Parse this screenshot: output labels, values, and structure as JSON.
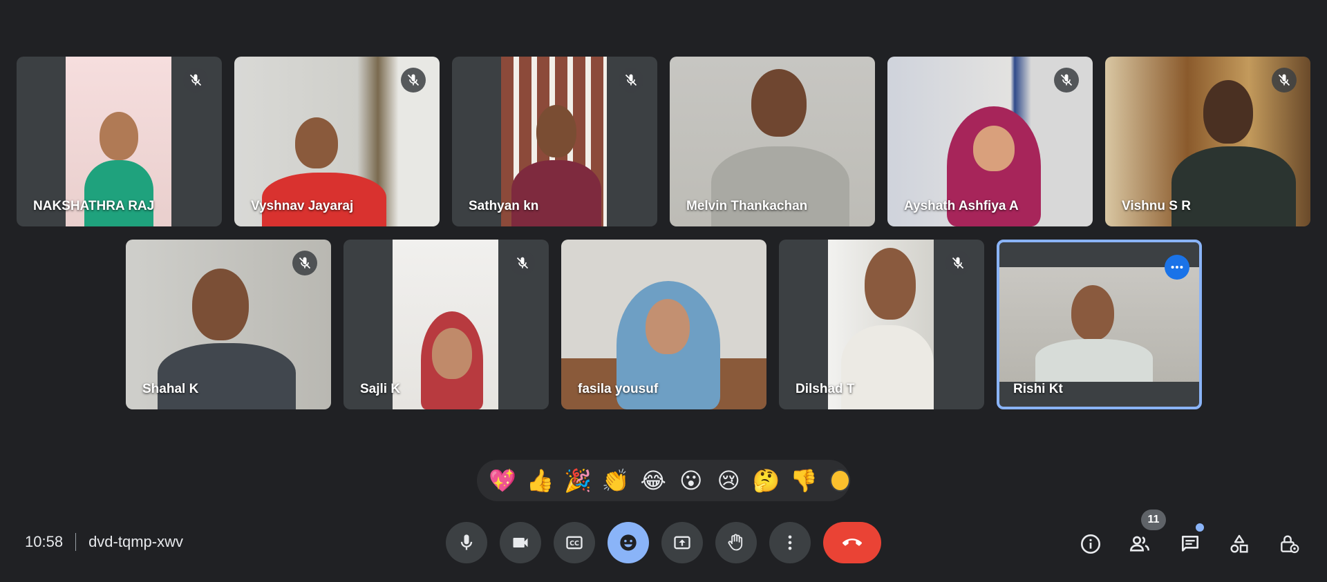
{
  "participants_row1": [
    {
      "name": "NAKSHATHRA RAJ",
      "muted": true
    },
    {
      "name": "Vyshnav Jayaraj",
      "muted": true
    },
    {
      "name": "Sathyan kn",
      "muted": true
    },
    {
      "name": "Melvin Thankachan",
      "muted": false
    },
    {
      "name": "Ayshath Ashfiya A",
      "muted": true
    },
    {
      "name": "Vishnu S R",
      "muted": true
    }
  ],
  "participants_row2": [
    {
      "name": "Shahal K",
      "muted": true
    },
    {
      "name": "Sajli K",
      "muted": true
    },
    {
      "name": "fasila yousuf",
      "muted": false
    },
    {
      "name": "Dilshad T",
      "muted": true
    },
    {
      "name": "Rishi Kt",
      "muted": false,
      "is_self": true
    }
  ],
  "reactions": [
    "💖",
    "👍",
    "🎉",
    "👏",
    "😂",
    "😮",
    "😢",
    "🤔",
    "👎"
  ],
  "meeting": {
    "time": "10:58",
    "code": "dvd-tqmp-xwv"
  },
  "people_count": "11",
  "colors": {
    "background": "#202124",
    "tile": "#3c4043",
    "accent": "#8ab4f8",
    "leave": "#ea4335",
    "self_more": "#1a73e8"
  },
  "controls": [
    "mic-icon",
    "camera-icon",
    "captions-icon",
    "emoji-icon",
    "present-icon",
    "raise-hand-icon",
    "more-options-icon",
    "leave-call-icon"
  ],
  "side_controls": [
    "info-icon",
    "people-icon",
    "chat-icon",
    "activities-icon",
    "host-controls-icon"
  ]
}
